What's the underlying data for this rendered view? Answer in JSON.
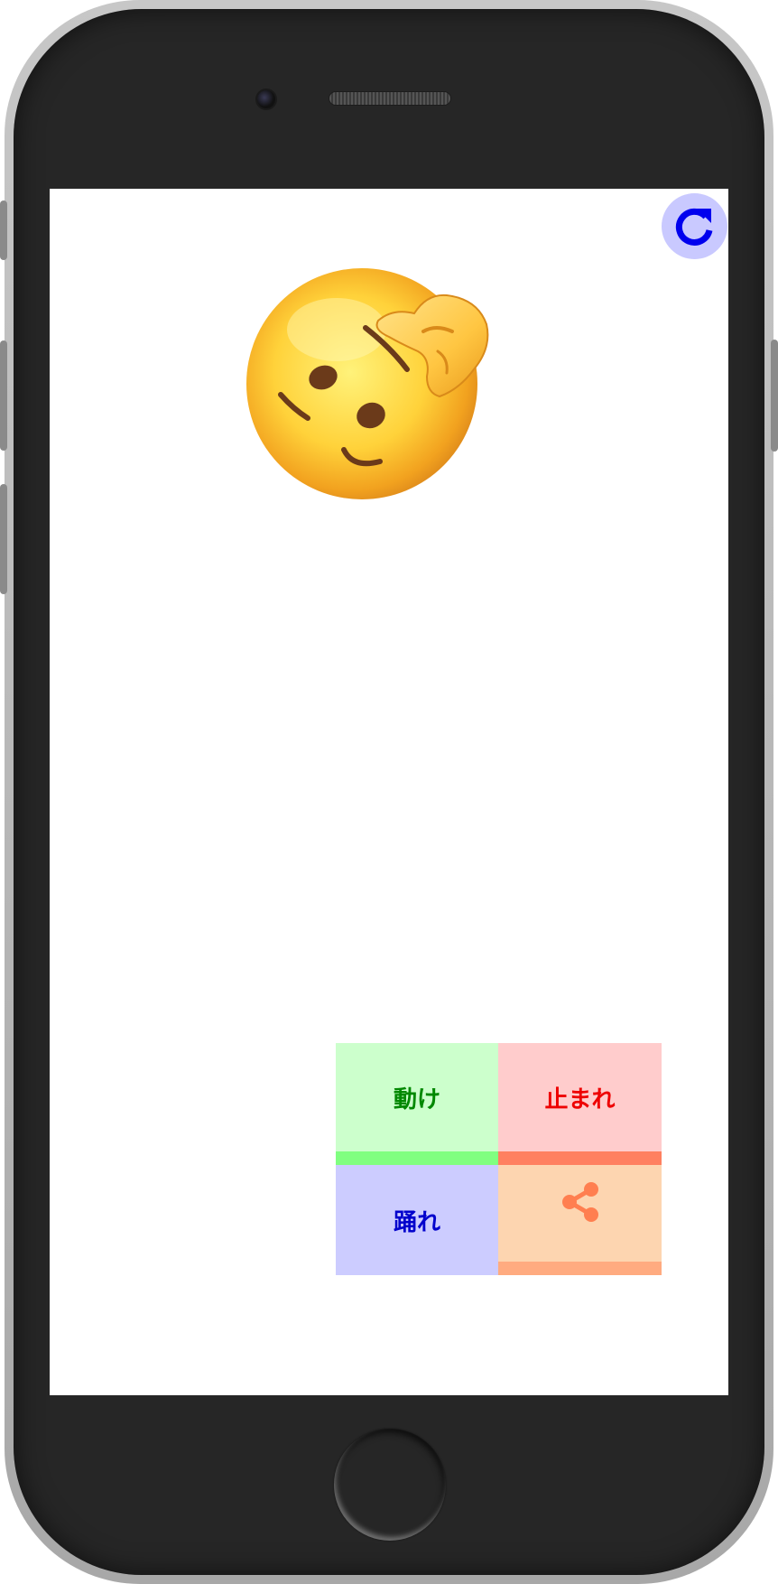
{
  "buttons": {
    "move_label": "動け",
    "stop_label": "止まれ",
    "dance_label": "踊れ"
  },
  "icons": {
    "reload": "reload-icon",
    "share": "share-icon",
    "emoji": "face-with-hand-over-forehead-emoji"
  },
  "colors": {
    "screen_background": "#ffffff",
    "reload_button": "#c9c9ff",
    "reload_icon": "#0000ee",
    "move_button": "#ccffcc",
    "move_text": "#008800",
    "stop_button": "#ffcccc",
    "stop_text": "#ee0000",
    "dance_button": "#ccccff",
    "dance_text": "#0000cc",
    "share_button": "#fdd5b0",
    "share_icon": "#ff7f50"
  }
}
